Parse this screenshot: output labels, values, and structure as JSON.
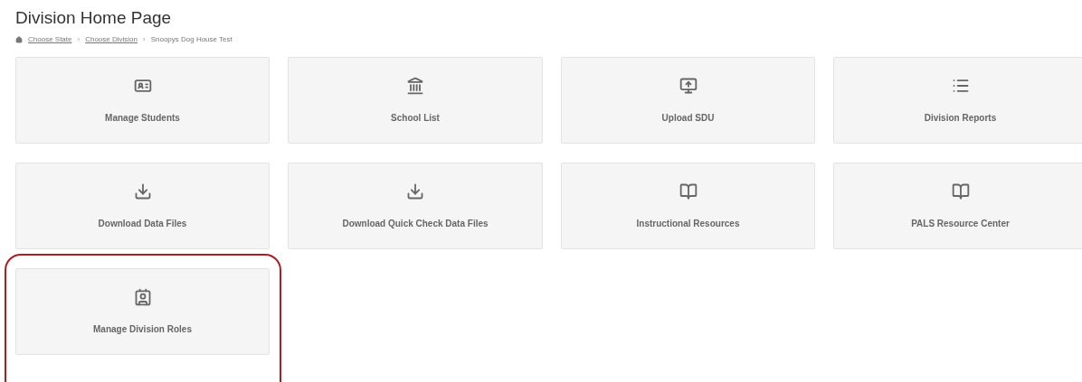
{
  "page_title": "Division Home Page",
  "breadcrumb": [
    {
      "label": "Choose State",
      "kind": "home_link"
    },
    {
      "separator": "›",
      "label": "Choose Division",
      "kind": "link"
    },
    {
      "separator": "›",
      "label": "Snoopys Dog House Test",
      "kind": "current"
    }
  ],
  "tiles": [
    {
      "label": "Manage Students",
      "kind": "id-card",
      "highlighted": false
    },
    {
      "label": "School List",
      "kind": "building",
      "highlighted": false
    },
    {
      "label": "Upload SDU",
      "kind": "upload",
      "highlighted": false
    },
    {
      "label": "Division Reports",
      "kind": "list",
      "highlighted": false
    },
    {
      "label": "Download Data Files",
      "kind": "download",
      "highlighted": false
    },
    {
      "label": "Download Quick Check Data Files",
      "kind": "download",
      "highlighted": false
    },
    {
      "label": "Instructional Resources",
      "kind": "book",
      "highlighted": false
    },
    {
      "label": "PALS Resource Center",
      "kind": "book",
      "highlighted": false
    },
    {
      "label": "Manage Division Roles",
      "kind": "badge",
      "highlighted": true
    }
  ]
}
